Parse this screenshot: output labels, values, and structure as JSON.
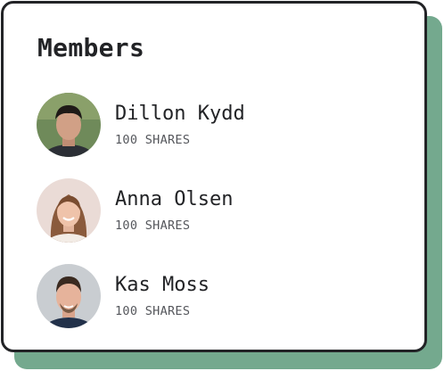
{
  "card": {
    "title": "Members"
  },
  "members": [
    {
      "name": "Dillon Kydd",
      "shares": "100 SHARES",
      "avatar": "avatar-photo-dillon-kydd"
    },
    {
      "name": "Anna Olsen",
      "shares": "100 SHARES",
      "avatar": "avatar-photo-anna-olsen"
    },
    {
      "name": "Kas Moss",
      "shares": "100 SHARES",
      "avatar": "avatar-photo-kas-moss"
    }
  ],
  "colors": {
    "accent_shadow": "#74a98e",
    "border": "#222326",
    "text": "#222326",
    "muted_text": "#55575c"
  }
}
